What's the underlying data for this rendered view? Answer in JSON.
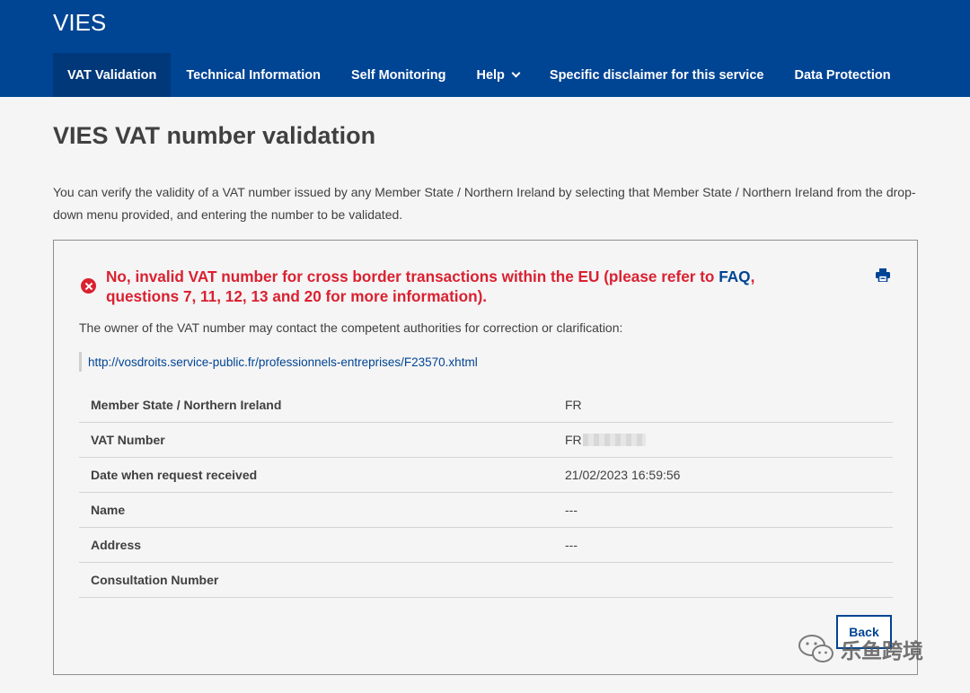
{
  "header": {
    "brand": "VIES",
    "nav": [
      {
        "label": "VAT Validation"
      },
      {
        "label": "Technical Information"
      },
      {
        "label": "Self Monitoring"
      },
      {
        "label": "Help"
      },
      {
        "label": "Specific disclaimer for this service"
      },
      {
        "label": "Data Protection"
      }
    ]
  },
  "main": {
    "title": "VIES VAT number validation",
    "intro": "You can verify the validity of a VAT number issued by any Member State / Northern Ireland by selecting that Member State / Northern Ireland from the drop-down menu provided, and entering the number to be validated."
  },
  "result": {
    "error_prefix": "No, invalid VAT number for cross border transactions within the EU (please refer to ",
    "faq_link": "FAQ",
    "error_suffix": ", questions 7, 11, 12, 13 and 20 for more information).",
    "owner_note": "The owner of the VAT number may contact the competent authorities for correction or clarification:",
    "authority_link": "http://vosdroits.service-public.fr/professionnels-entreprises/F23570.xhtml",
    "rows": [
      {
        "label": "Member State / Northern Ireland",
        "value": "FR"
      },
      {
        "label": "VAT Number",
        "value": "FR"
      },
      {
        "label": "Date when request received",
        "value": "21/02/2023 16:59:56"
      },
      {
        "label": "Name",
        "value": "---"
      },
      {
        "label": "Address",
        "value": "---"
      },
      {
        "label": "Consultation Number",
        "value": ""
      }
    ],
    "back_label": "Back"
  },
  "watermark": {
    "text": "乐鱼跨境"
  },
  "colors": {
    "header_bg": "#004494",
    "error": "#da2131",
    "link": "#004494"
  },
  "icons": {
    "error": "error-circle-icon",
    "print": "print-icon",
    "help_dropdown": "chevron-down-icon"
  }
}
